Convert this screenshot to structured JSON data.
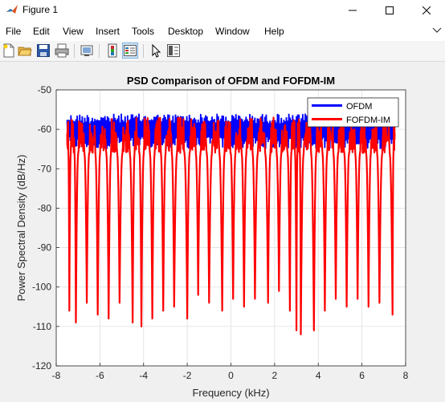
{
  "window": {
    "title": "Figure 1"
  },
  "menu": [
    "File",
    "Edit",
    "View",
    "Insert",
    "Tools",
    "Desktop",
    "Window",
    "Help"
  ],
  "toolbar": [
    "new-figure-icon",
    "open-file-icon",
    "save-icon",
    "print-icon",
    "link-plot-icon",
    "insert-colorbar-icon",
    "insert-legend-icon",
    "edit-plot-icon",
    "property-inspector-icon"
  ],
  "chart_data": {
    "type": "line",
    "title": "PSD Comparison of OFDM and FOFDM-IM",
    "xlabel": "Frequency (kHz)",
    "ylabel": "Power Spectral Density (dB/Hz)",
    "xlim": [
      -8,
      8
    ],
    "ylim": [
      -120,
      -50
    ],
    "xticks": [
      "-8",
      "-6",
      "-4",
      "-2",
      "0",
      "2",
      "4",
      "6",
      "8"
    ],
    "yticks": [
      "-50",
      "-60",
      "-70",
      "-80",
      "-90",
      "-100",
      "-110",
      "-120"
    ],
    "grid": true,
    "legend_position": "top-right",
    "series": [
      {
        "name": "OFDM",
        "color": "#0000ff",
        "x_range": [
          -7.5,
          7.5
        ],
        "level_top": -56,
        "level_bottom": -65
      },
      {
        "name": "FOFDM-IM",
        "color": "#ff0000",
        "x_range": [
          -7.5,
          7.5
        ],
        "peak": -57,
        "shoulder": -66,
        "nulls": [
          [
            -7.4,
            -106
          ],
          [
            -7.1,
            -109
          ],
          [
            -6.6,
            -104
          ],
          [
            -6.1,
            -107
          ],
          [
            -5.6,
            -108
          ],
          [
            -5.1,
            -104
          ],
          [
            -4.5,
            -109
          ],
          [
            -4.1,
            -110
          ],
          [
            -3.6,
            -108
          ],
          [
            -3.1,
            -106
          ],
          [
            -2.6,
            -105
          ],
          [
            -2.0,
            -108
          ],
          [
            -1.5,
            -102
          ],
          [
            -1.0,
            -104
          ],
          [
            -0.4,
            -106
          ],
          [
            0.1,
            -103
          ],
          [
            0.6,
            -105
          ],
          [
            1.1,
            -103
          ],
          [
            1.7,
            -104
          ],
          [
            2.2,
            -101
          ],
          [
            2.7,
            -106
          ],
          [
            3.0,
            -111
          ],
          [
            3.2,
            -112
          ],
          [
            3.8,
            -111
          ],
          [
            4.3,
            -106
          ],
          [
            4.8,
            -103
          ],
          [
            5.3,
            -105
          ],
          [
            5.8,
            -103
          ],
          [
            6.3,
            -105
          ],
          [
            6.8,
            -104
          ],
          [
            7.4,
            -107
          ]
        ]
      }
    ]
  }
}
